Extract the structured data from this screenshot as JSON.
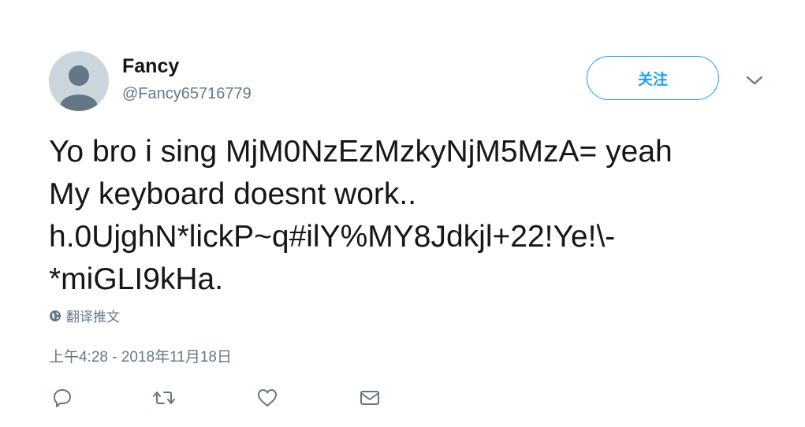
{
  "user": {
    "display_name": "Fancy",
    "handle": "@Fancy65716779",
    "avatar_icon": "default-profile-icon"
  },
  "follow_button": {
    "label": "关注"
  },
  "more_menu": {
    "icon": "chevron-down-icon"
  },
  "tweet": {
    "lines": [
      "Yo bro i sing MjM0NzEzMzkyNjM5MzA= yeah",
      "My keyboard doesnt work..",
      "h.0UjghN*lickP~q#ilY%MY8Jdkjl+22!Ye!\\-",
      "*miGLI9kHa."
    ]
  },
  "translate": {
    "label": "翻译推文",
    "icon": "globe-icon"
  },
  "timestamp": "上午4:28 - 2018年11月18日",
  "actions": {
    "reply_icon": "reply-icon",
    "retweet_icon": "retweet-icon",
    "like_icon": "heart-icon",
    "dm_icon": "envelope-icon"
  },
  "colors": {
    "accent": "#1da1f2",
    "text": "#14171a",
    "secondary_text": "#657786",
    "avatar_bg": "#ccd6dd"
  }
}
